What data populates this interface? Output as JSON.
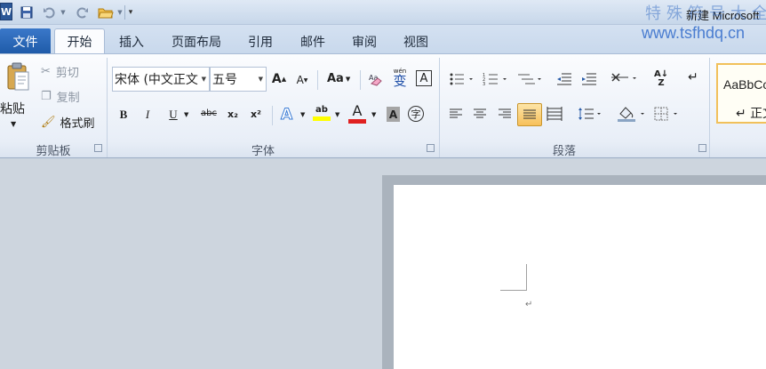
{
  "title_bar": {
    "app_icon_letter": "W",
    "document_title": "新建 Microsoft"
  },
  "watermark": {
    "line1": "特殊符号大全",
    "line2": "www.tsfhdq.cn"
  },
  "tabs": {
    "file": "文件",
    "items": [
      "开始",
      "插入",
      "页面布局",
      "引用",
      "邮件",
      "审阅",
      "视图"
    ],
    "active": "开始"
  },
  "clipboard": {
    "paste": "粘贴",
    "cut": "剪切",
    "copy": "复制",
    "format_painter": "格式刷",
    "group_label": "剪贴板"
  },
  "font": {
    "font_name": "宋体 (中文正文",
    "font_size": "五号",
    "group_label": "字体",
    "bold": "B",
    "italic": "I",
    "underline": "U",
    "strikethrough": "abc",
    "subscript": "x₂",
    "superscript": "x²",
    "grow_font": "A",
    "shrink_font": "A",
    "change_case": "Aa",
    "phonetic": "wén",
    "phonetic_char": "变",
    "border_char": "A",
    "text_effects": "A",
    "highlight": "ab",
    "font_color": "A",
    "char_shading": "A",
    "enclose_char": "字"
  },
  "paragraph": {
    "group_label": "段落"
  },
  "styles": {
    "sample": "AaBbCc",
    "name": "↵ 正文"
  },
  "colors": {
    "file_tab": "#1e5aa8",
    "highlight": "#ffff00",
    "font_color": "#e02020",
    "active_button": "#f7d07a"
  }
}
